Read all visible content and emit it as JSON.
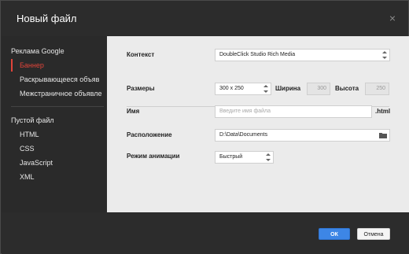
{
  "dialog": {
    "title": "Новый файл",
    "close_glyph": "×"
  },
  "sidebar": {
    "groups": [
      {
        "title": "Реклама Google",
        "items": [
          {
            "label": "Баннер",
            "active": true
          },
          {
            "label": "Раскрывающееся объяв"
          },
          {
            "label": "Межстраничное объявле"
          }
        ]
      },
      {
        "title": "Пустой файл",
        "items": [
          {
            "label": "HTML"
          },
          {
            "label": "CSS"
          },
          {
            "label": "JavaScript"
          },
          {
            "label": "XML"
          }
        ]
      }
    ]
  },
  "form": {
    "context": {
      "label": "Контекст",
      "value": "DoubleClick Studio Rich Media"
    },
    "sizes": {
      "label": "Размеры",
      "value": "300 x 250",
      "width_label": "Ширина",
      "width_value": "300",
      "height_label": "Высота",
      "height_value": "250"
    },
    "name": {
      "label": "Имя",
      "placeholder": "Введите имя файла",
      "suffix": ".html"
    },
    "location": {
      "label": "Расположение",
      "value": "D:\\Data\\Documents"
    },
    "animation": {
      "label": "Режим анимации",
      "value": "Быстрый"
    }
  },
  "footer": {
    "ok_label": "ОК",
    "cancel_label": "Отмена"
  },
  "colors": {
    "accent": "#e0443a",
    "primary_button": "#3d86e6",
    "dark_bg": "#2c2c2c",
    "content_bg": "#ebebeb"
  },
  "icons": {
    "close": "close-icon",
    "folder": "folder-icon",
    "select_arrows": "select-arrows-icon"
  }
}
